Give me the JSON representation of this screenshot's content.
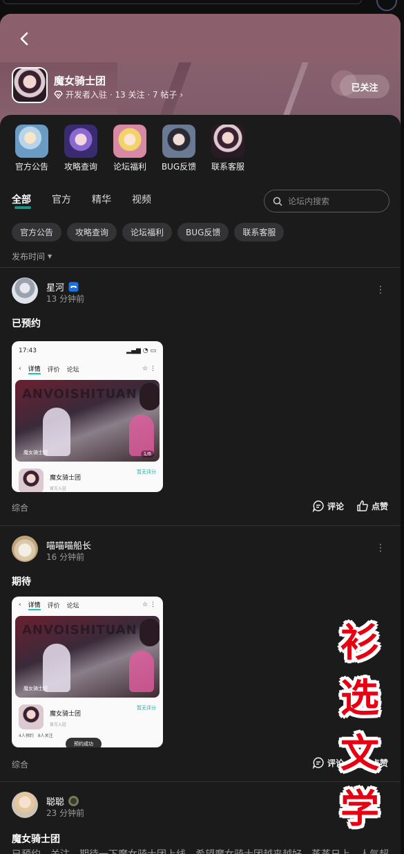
{
  "header": {
    "game_name": "魔女骑士团",
    "meta": "开发者入驻 · 13 关注 · 7 帖子",
    "follow_label": "已关注"
  },
  "shortcuts": [
    {
      "label": "官方公告"
    },
    {
      "label": "攻略查询"
    },
    {
      "label": "论坛福利"
    },
    {
      "label": "BUG反馈"
    },
    {
      "label": "联系客服"
    }
  ],
  "tabs": [
    {
      "label": "全部",
      "active": true
    },
    {
      "label": "官方"
    },
    {
      "label": "精华"
    },
    {
      "label": "视频"
    }
  ],
  "search": {
    "placeholder": "论坛内搜索"
  },
  "chips": [
    "官方公告",
    "攻略查询",
    "论坛福利",
    "BUG反馈",
    "联系客服"
  ],
  "sort_label": "发布时间",
  "posts": [
    {
      "user": "星河",
      "time": "13 分钟前",
      "title": "已预约",
      "tag": "综合",
      "comment_label": "评论",
      "like_label": "点赞",
      "shot": {
        "status_time": "17:43",
        "nav": [
          "详情",
          "评价",
          "论坛"
        ],
        "banner_text": "ANVOISHITUAN",
        "banner_label": "魔女骑士团",
        "banner_num": "1/6",
        "app_name": "魔女骑士团",
        "app_rating": "暂无评分",
        "app_official": "官方入驻"
      }
    },
    {
      "user": "喵喵喵船长",
      "time": "16 分钟前",
      "title": "期待",
      "tag": "综合",
      "comment_label": "评论",
      "like_label": "点赞",
      "shot": {
        "nav": [
          "详情",
          "评价",
          "论坛"
        ],
        "banner_text": "ANVOISHITUAN",
        "banner_label": "魔女骑士团",
        "app_name": "魔女骑士团",
        "app_rating": "暂无评分",
        "app_official": "官方入驻",
        "stats": "4人预约　8人关注",
        "toast": "预约成功"
      }
    },
    {
      "user": "聪聪",
      "time": "23 分钟前",
      "title": "魔女骑士团",
      "excerpt": "已预约，关注，期待一下魔女骑士团上线，希望魔女骑士团越来越好，蒸蒸日上，人气超"
    }
  ],
  "watermark": [
    "衫",
    "选",
    "文",
    "学"
  ],
  "colors": {
    "accent": "#17c6b7",
    "hero": "#8c5f6c",
    "watermark": "#e60012",
    "background": "#1b1b1c"
  }
}
